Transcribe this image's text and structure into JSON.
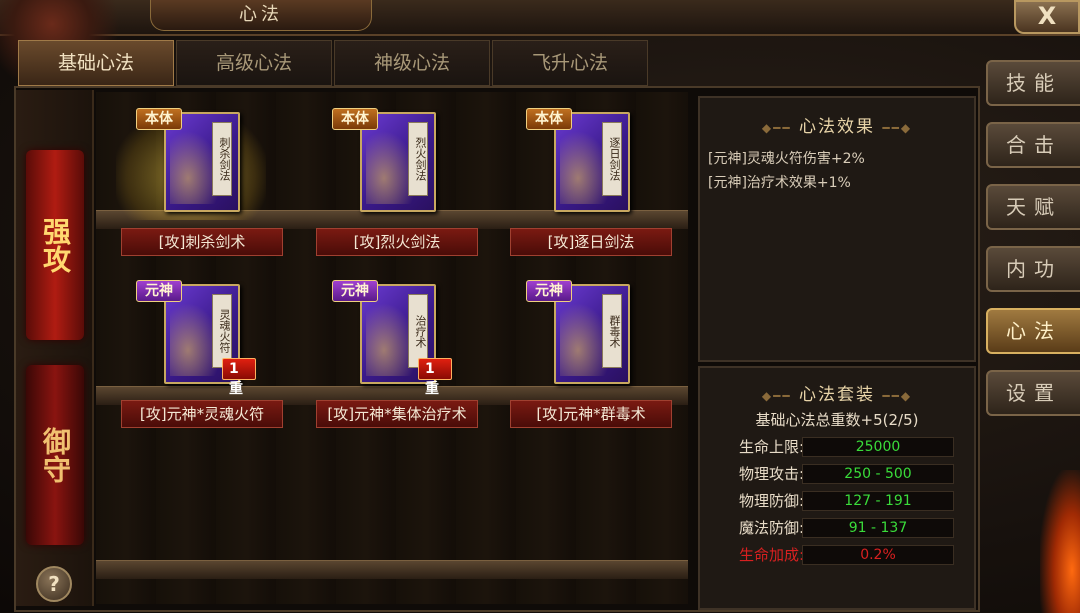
{
  "window": {
    "title": "心法",
    "close_label": "X"
  },
  "tabs": [
    {
      "label": "基础心法",
      "active": true
    },
    {
      "label": "高级心法",
      "active": false
    },
    {
      "label": "神级心法",
      "active": false
    },
    {
      "label": "飞升心法",
      "active": false
    }
  ],
  "categories": [
    {
      "label": "强攻",
      "active": true
    },
    {
      "label": "御守",
      "active": false
    }
  ],
  "help_label": "?",
  "books": [
    {
      "tag": "本体",
      "tag_color": "#c07020",
      "cover_text": "刺杀剑法",
      "name": "[攻]刺杀剑术",
      "level": "",
      "glow": true
    },
    {
      "tag": "本体",
      "tag_color": "#c07020",
      "cover_text": "烈火剑法",
      "name": "[攻]烈火剑法",
      "level": "",
      "glow": false
    },
    {
      "tag": "本体",
      "tag_color": "#c07020",
      "cover_text": "逐日剑法",
      "name": "[攻]逐日剑法",
      "level": "",
      "glow": false
    },
    {
      "tag": "元神",
      "tag_color": "#a040d0",
      "cover_text": "灵魂火符",
      "name": "[攻]元神*灵魂火符",
      "level": "1重",
      "glow": false
    },
    {
      "tag": "元神",
      "tag_color": "#a040d0",
      "cover_text": "治疗术",
      "name": "[攻]元神*集体治疗术",
      "level": "1重",
      "glow": false
    },
    {
      "tag": "元神",
      "tag_color": "#a040d0",
      "cover_text": "群毒术",
      "name": "[攻]元神*群毒术",
      "level": "",
      "glow": false
    }
  ],
  "effects_panel": {
    "title": "心法效果",
    "items": [
      "[元神]灵魂火符伤害+2%",
      "[元神]治疗术效果+1%"
    ]
  },
  "set_panel": {
    "title": "心法套装",
    "subtitle": "基础心法总重数+5(2/5)",
    "stats": [
      {
        "label": "生命上限:",
        "value": "25000",
        "highlight": false
      },
      {
        "label": "物理攻击:",
        "value": "250 - 500",
        "highlight": false
      },
      {
        "label": "物理防御:",
        "value": "127 - 191",
        "highlight": false
      },
      {
        "label": "魔法防御:",
        "value": "91 - 137",
        "highlight": false
      },
      {
        "label": "生命加成:",
        "value": "0.2%",
        "highlight": true
      }
    ]
  },
  "side_menu": [
    {
      "label": "技能",
      "active": false
    },
    {
      "label": "合击",
      "active": false
    },
    {
      "label": "天赋",
      "active": false
    },
    {
      "label": "内功",
      "active": false
    },
    {
      "label": "心法",
      "active": true
    },
    {
      "label": "设置",
      "active": false
    }
  ],
  "colors": {
    "stat_green": "#3adc3a",
    "stat_red": "#d82020",
    "tab_active": "#6a4a2c"
  }
}
